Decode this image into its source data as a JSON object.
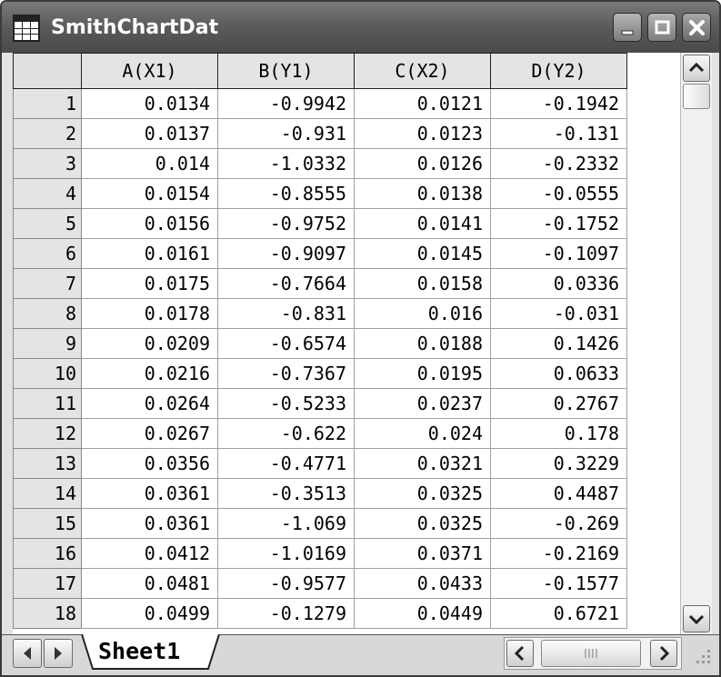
{
  "window": {
    "title": "SmithChartDat"
  },
  "table": {
    "columns": [
      "A(X1)",
      "B(Y1)",
      "C(X2)",
      "D(Y2)"
    ],
    "rows": [
      {
        "n": "1",
        "a": "0.0134",
        "b": "-0.9942",
        "c": "0.0121",
        "d": "-0.1942"
      },
      {
        "n": "2",
        "a": "0.0137",
        "b": "-0.931",
        "c": "0.0123",
        "d": "-0.131"
      },
      {
        "n": "3",
        "a": "0.014",
        "b": "-1.0332",
        "c": "0.0126",
        "d": "-0.2332"
      },
      {
        "n": "4",
        "a": "0.0154",
        "b": "-0.8555",
        "c": "0.0138",
        "d": "-0.0555"
      },
      {
        "n": "5",
        "a": "0.0156",
        "b": "-0.9752",
        "c": "0.0141",
        "d": "-0.1752"
      },
      {
        "n": "6",
        "a": "0.0161",
        "b": "-0.9097",
        "c": "0.0145",
        "d": "-0.1097"
      },
      {
        "n": "7",
        "a": "0.0175",
        "b": "-0.7664",
        "c": "0.0158",
        "d": "0.0336"
      },
      {
        "n": "8",
        "a": "0.0178",
        "b": "-0.831",
        "c": "0.016",
        "d": "-0.031"
      },
      {
        "n": "9",
        "a": "0.0209",
        "b": "-0.6574",
        "c": "0.0188",
        "d": "0.1426"
      },
      {
        "n": "10",
        "a": "0.0216",
        "b": "-0.7367",
        "c": "0.0195",
        "d": "0.0633"
      },
      {
        "n": "11",
        "a": "0.0264",
        "b": "-0.5233",
        "c": "0.0237",
        "d": "0.2767"
      },
      {
        "n": "12",
        "a": "0.0267",
        "b": "-0.622",
        "c": "0.024",
        "d": "0.178"
      },
      {
        "n": "13",
        "a": "0.0356",
        "b": "-0.4771",
        "c": "0.0321",
        "d": "0.3229"
      },
      {
        "n": "14",
        "a": "0.0361",
        "b": "-0.3513",
        "c": "0.0325",
        "d": "0.4487"
      },
      {
        "n": "15",
        "a": "0.0361",
        "b": "-1.069",
        "c": "0.0325",
        "d": "-0.269"
      },
      {
        "n": "16",
        "a": "0.0412",
        "b": "-1.0169",
        "c": "0.0371",
        "d": "-0.2169"
      },
      {
        "n": "17",
        "a": "0.0481",
        "b": "-0.9577",
        "c": "0.0433",
        "d": "-0.1577"
      },
      {
        "n": "18",
        "a": "0.0499",
        "b": "-0.1279",
        "c": "0.0449",
        "d": "0.6721"
      }
    ]
  },
  "sheet_tabs": [
    "Sheet1"
  ],
  "icons": {
    "app": "worksheet-icon",
    "minimize": "minimize-icon",
    "maximize": "maximize-icon",
    "close": "close-icon",
    "scroll_up": "chevron-up-icon",
    "scroll_down": "chevron-down-icon",
    "scroll_left": "chevron-left-icon",
    "scroll_right": "chevron-right-icon",
    "tab_first": "triangle-left-icon",
    "tab_next": "triangle-right-icon",
    "resize": "resize-grip-icon"
  },
  "colors": {
    "titlebar": "#5a5a5a",
    "header_bg": "#e4e4e4",
    "grid_line": "#a0a0a0"
  }
}
